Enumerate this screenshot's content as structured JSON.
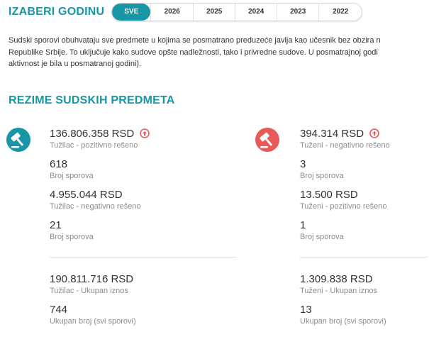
{
  "year_selector": {
    "title": "IZABERI GODINU",
    "options": [
      "SVE",
      "2026",
      "2025",
      "2024",
      "2023",
      "2022"
    ],
    "active": "SVE"
  },
  "intro": {
    "line1": "Sudski sporovi obuhvataju sve predmete u kojima se posmatrano preduzeće javlja kao učesnik bez obzira n",
    "line2": "Republike Srbije. To uključuje kako sudove opšte nadležnosti, tako i privredne sudove. U posmatrajnoj godi",
    "line3": "aktivnost je bila u posmatranoj godini)."
  },
  "summary": {
    "title": "REZIME SUDSKIH PREDMETA",
    "plaintiff": {
      "icon": "gavel-icon",
      "color": "#1797a6",
      "positive_amount": "136.806.358 RSD",
      "positive_amount_label": "Tužilac - pozitivno rešeno",
      "positive_count": "618",
      "positive_count_label": "Broj sporova",
      "negative_amount": "4.955.044 RSD",
      "negative_amount_label": "Tužilac - negativno rešeno",
      "negative_count": "21",
      "negative_count_label": "Broj sporova",
      "total_amount": "190.811.716 RSD",
      "total_amount_label": "Tužilac - Ukupan iznos",
      "total_count": "744",
      "total_count_label": "Ukupan broj (svi sporovi)"
    },
    "defendant": {
      "icon": "gavel-icon",
      "color": "#e85a5a",
      "negative_amount": "394.314 RSD",
      "negative_amount_label": "Tuženi - negativno rešeno",
      "negative_count": "3",
      "negative_count_label": "Broj sporova",
      "positive_amount": "13.500 RSD",
      "positive_amount_label": "Tuženi - pozitivno rešeno",
      "positive_count": "1",
      "positive_count_label": "Broj sporova",
      "total_amount": "1.309.838 RSD",
      "total_amount_label": "Tuženi - Ukupan iznos",
      "total_count": "13",
      "total_count_label": "Ukupan broj (svi sporovi)"
    },
    "trend_icon": "arrow-up-circle-icon",
    "trend_color": "#e85a5a"
  }
}
